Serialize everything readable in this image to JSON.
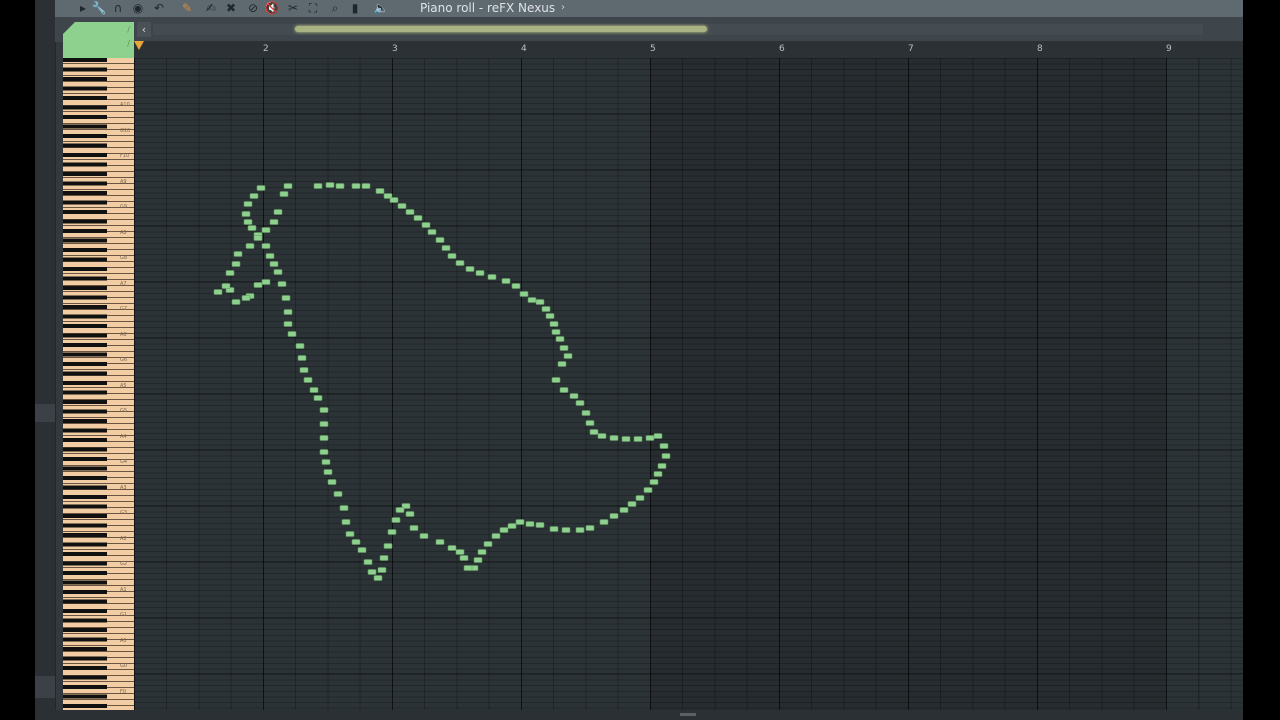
{
  "window": {
    "title": "Piano roll - reFX Nexus",
    "title_arrow": "›"
  },
  "toolbar": {
    "tools": [
      {
        "name": "menu-arrow-icon",
        "glyph": "▸",
        "style": "dark"
      },
      {
        "name": "wrench-icon",
        "glyph": "🔧",
        "style": "dark"
      },
      {
        "name": "magnet-icon",
        "glyph": "∩",
        "style": "dark"
      },
      {
        "name": "record-icon",
        "glyph": "◉",
        "style": "dark"
      },
      {
        "name": "undo-icon",
        "glyph": "↶",
        "style": "dark"
      },
      {
        "name": "pencil-icon",
        "glyph": "✎",
        "style": "orange"
      },
      {
        "name": "brush-icon",
        "glyph": "✍",
        "style": "dark"
      },
      {
        "name": "delete-icon",
        "glyph": "✖",
        "style": "dark"
      },
      {
        "name": "mute-icon",
        "glyph": "⊘",
        "style": "dark"
      },
      {
        "name": "speaker-mute-icon",
        "glyph": "🔇",
        "style": "dark"
      },
      {
        "name": "slice-icon",
        "glyph": "✂",
        "style": "dark"
      },
      {
        "name": "select-icon",
        "glyph": "⛶",
        "style": "dark"
      },
      {
        "name": "zoom-icon",
        "glyph": "⌕",
        "style": "dark"
      },
      {
        "name": "playback-icon",
        "glyph": "▮",
        "style": "dark"
      },
      {
        "name": "speaker-icon",
        "glyph": "🔈",
        "style": "dark"
      }
    ]
  },
  "tab": {
    "marks": [
      "/",
      "/"
    ]
  },
  "scroll": {
    "left_arrow": "‹"
  },
  "ruler": {
    "bars": [
      "2",
      "3",
      "4",
      "5",
      "6",
      "7",
      "8",
      "9"
    ]
  },
  "keyboard": {
    "labels": [
      "A10",
      "G10",
      "F10",
      "A9",
      "G9",
      "A8",
      "G8",
      "A7",
      "G7",
      "A6",
      "G6",
      "A5",
      "G5",
      "A4",
      "G4",
      "A3",
      "G3",
      "A2",
      "G2",
      "A1",
      "G1",
      "A0",
      "G0",
      "F0"
    ]
  },
  "colors": {
    "note": "#8ed08e",
    "note_border": "#5f9a5f",
    "playhead": "#e8a53a"
  },
  "notes": [
    [
      184,
      128
    ],
    [
      196,
      127
    ],
    [
      206,
      128
    ],
    [
      222,
      128
    ],
    [
      232,
      128
    ],
    [
      246,
      133
    ],
    [
      254,
      138
    ],
    [
      260,
      142
    ],
    [
      268,
      148
    ],
    [
      276,
      154
    ],
    [
      284,
      160
    ],
    [
      292,
      167
    ],
    [
      298,
      174
    ],
    [
      306,
      182
    ],
    [
      312,
      190
    ],
    [
      318,
      198
    ],
    [
      326,
      205
    ],
    [
      336,
      211
    ],
    [
      346,
      215
    ],
    [
      358,
      219
    ],
    [
      372,
      223
    ],
    [
      382,
      228
    ],
    [
      390,
      236
    ],
    [
      398,
      242
    ],
    [
      406,
      244
    ],
    [
      412,
      251
    ],
    [
      416,
      258
    ],
    [
      420,
      266
    ],
    [
      422,
      274
    ],
    [
      426,
      281
    ],
    [
      430,
      290
    ],
    [
      434,
      298
    ],
    [
      428,
      306
    ],
    [
      422,
      322
    ],
    [
      430,
      332
    ],
    [
      440,
      338
    ],
    [
      446,
      345
    ],
    [
      452,
      355
    ],
    [
      456,
      365
    ],
    [
      460,
      374
    ],
    [
      468,
      378
    ],
    [
      480,
      380
    ],
    [
      492,
      381
    ],
    [
      504,
      381
    ],
    [
      516,
      380
    ],
    [
      524,
      378
    ],
    [
      530,
      388
    ],
    [
      532,
      398
    ],
    [
      528,
      408
    ],
    [
      524,
      416
    ],
    [
      520,
      424
    ],
    [
      514,
      432
    ],
    [
      506,
      440
    ],
    [
      498,
      446
    ],
    [
      490,
      452
    ],
    [
      480,
      458
    ],
    [
      470,
      464
    ],
    [
      456,
      470
    ],
    [
      446,
      472
    ],
    [
      432,
      472
    ],
    [
      420,
      471
    ],
    [
      406,
      467
    ],
    [
      396,
      466
    ],
    [
      386,
      464
    ],
    [
      378,
      468
    ],
    [
      370,
      472
    ],
    [
      362,
      478
    ],
    [
      354,
      486
    ],
    [
      348,
      494
    ],
    [
      344,
      502
    ],
    [
      340,
      510
    ],
    [
      334,
      510
    ],
    [
      330,
      500
    ],
    [
      326,
      494
    ],
    [
      318,
      490
    ],
    [
      306,
      484
    ],
    [
      290,
      478
    ],
    [
      280,
      470
    ],
    [
      276,
      456
    ],
    [
      272,
      448
    ],
    [
      266,
      452
    ],
    [
      262,
      462
    ],
    [
      258,
      474
    ],
    [
      254,
      488
    ],
    [
      250,
      500
    ],
    [
      248,
      512
    ],
    [
      244,
      520
    ],
    [
      238,
      514
    ],
    [
      234,
      504
    ],
    [
      228,
      492
    ],
    [
      222,
      484
    ],
    [
      216,
      476
    ],
    [
      212,
      464
    ],
    [
      210,
      450
    ],
    [
      204,
      436
    ],
    [
      198,
      424
    ],
    [
      194,
      414
    ],
    [
      192,
      404
    ],
    [
      190,
      394
    ],
    [
      190,
      380
    ],
    [
      190,
      366
    ],
    [
      190,
      352
    ],
    [
      184,
      340
    ],
    [
      180,
      332
    ],
    [
      174,
      322
    ],
    [
      170,
      312
    ],
    [
      168,
      300
    ],
    [
      166,
      288
    ],
    [
      158,
      276
    ],
    [
      154,
      266
    ],
    [
      154,
      254
    ],
    [
      152,
      240
    ],
    [
      148,
      226
    ],
    [
      144,
      214
    ],
    [
      140,
      206
    ],
    [
      136,
      198
    ],
    [
      132,
      188
    ],
    [
      124,
      177
    ],
    [
      118,
      170
    ],
    [
      114,
      164
    ],
    [
      112,
      156
    ],
    [
      114,
      146
    ],
    [
      120,
      138
    ],
    [
      127,
      130
    ],
    [
      132,
      224
    ],
    [
      124,
      227
    ],
    [
      116,
      238
    ],
    [
      102,
      244
    ],
    [
      96,
      232
    ],
    [
      112,
      240
    ],
    [
      84,
      234
    ],
    [
      92,
      228
    ],
    [
      96,
      215
    ],
    [
      102,
      206
    ],
    [
      104,
      196
    ],
    [
      116,
      188
    ],
    [
      124,
      180
    ],
    [
      132,
      172
    ],
    [
      140,
      164
    ],
    [
      144,
      154
    ],
    [
      150,
      136
    ],
    [
      154,
      128
    ]
  ]
}
